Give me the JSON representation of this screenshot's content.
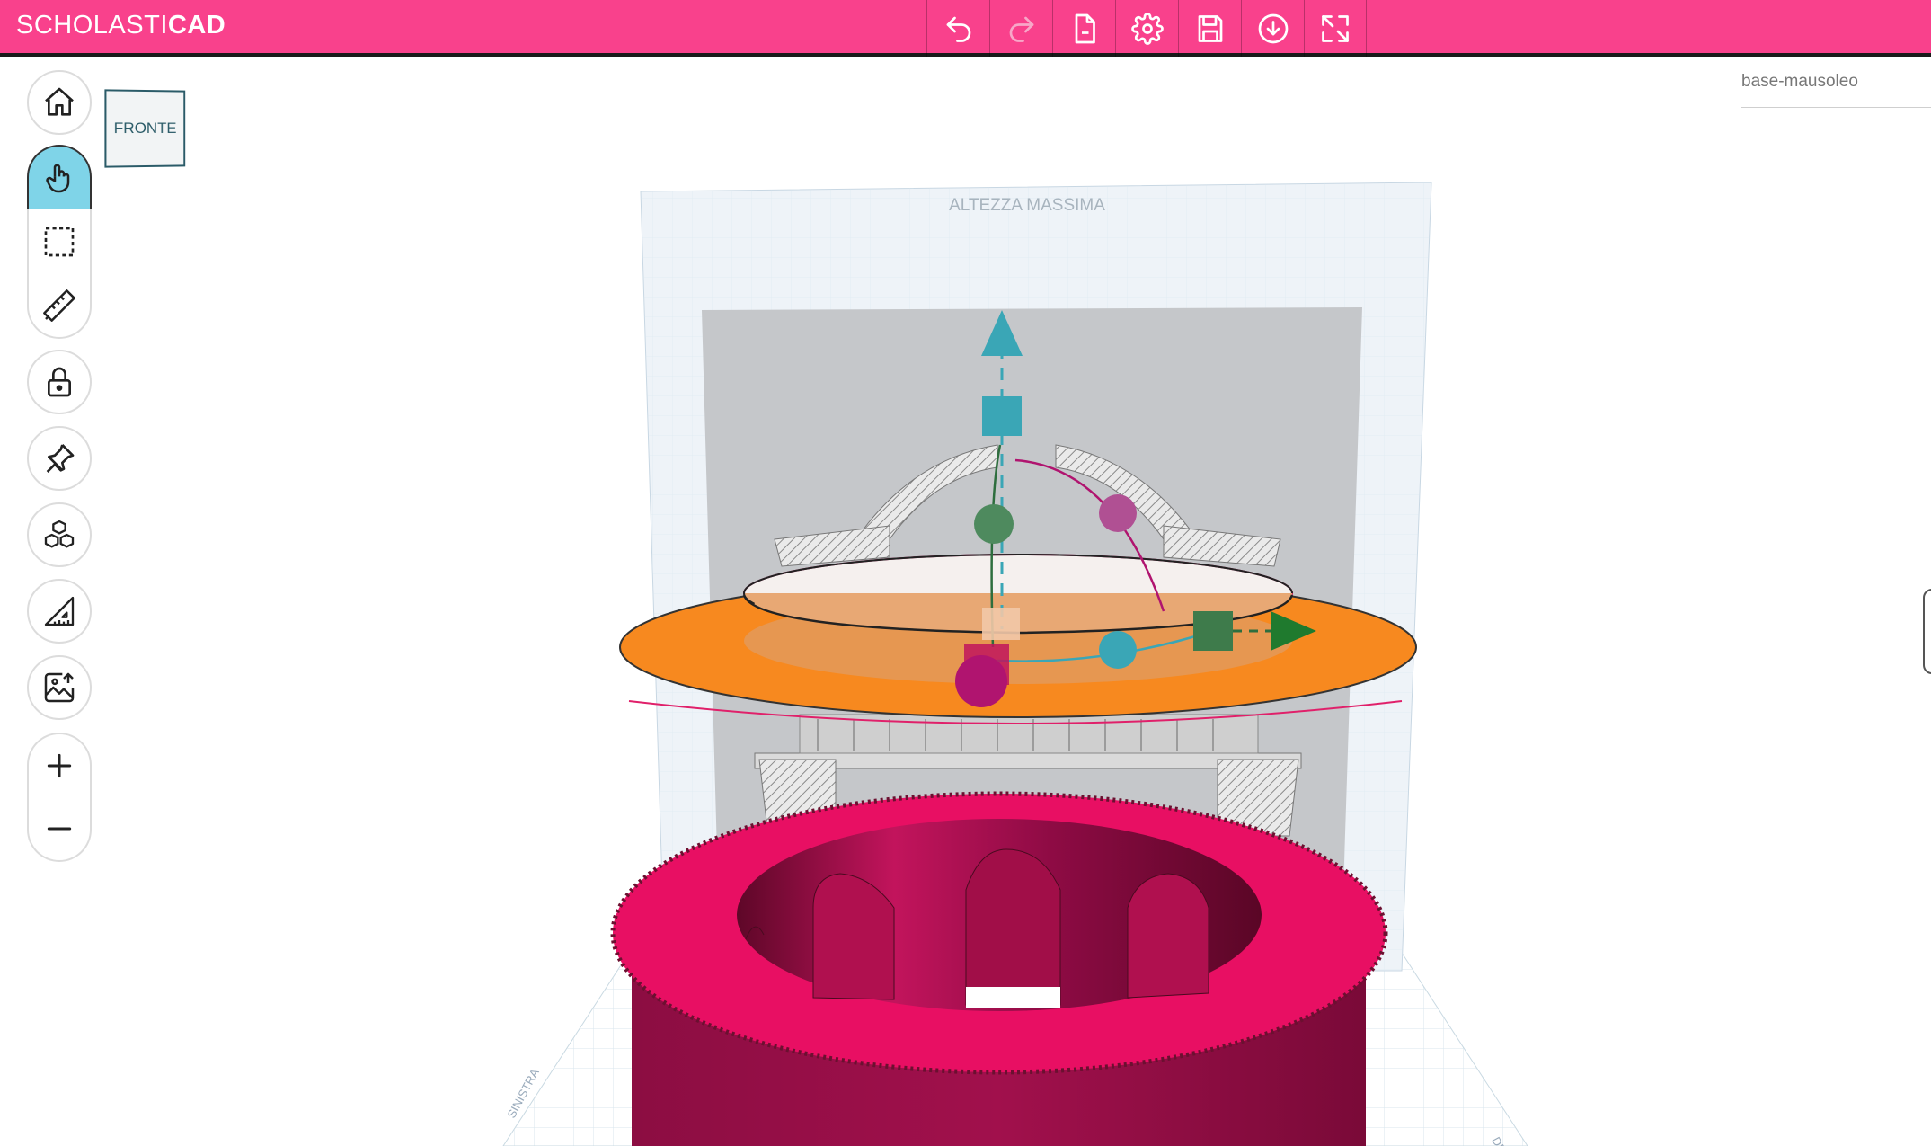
{
  "app": {
    "logo_light": "SCHOLASTI",
    "logo_bold": "CAD"
  },
  "toolbar": {
    "buttons": [
      {
        "icon": "undo-icon",
        "enabled": true
      },
      {
        "icon": "redo-icon",
        "enabled": false
      },
      {
        "icon": "new-file-icon",
        "enabled": true
      },
      {
        "icon": "gear-icon",
        "enabled": true
      },
      {
        "icon": "save-icon",
        "enabled": true
      },
      {
        "icon": "download-icon",
        "enabled": true
      },
      {
        "icon": "fullscreen-icon",
        "enabled": true
      }
    ]
  },
  "sidebar": {
    "tools": [
      {
        "icon": "home-icon"
      },
      {
        "icon": "hand-pointer-icon",
        "active": true
      },
      {
        "icon": "selection-box-icon"
      },
      {
        "icon": "ruler-icon"
      },
      {
        "icon": "lock-icon"
      },
      {
        "icon": "pin-icon"
      },
      {
        "icon": "cubes-icon"
      },
      {
        "icon": "set-square-icon"
      },
      {
        "icon": "image-upload-icon"
      },
      {
        "icon": "zoom-in-icon"
      },
      {
        "icon": "zoom-out-icon"
      }
    ]
  },
  "view_cube": {
    "face_label": "FRONTE"
  },
  "model": {
    "name": "base-mausoleo"
  },
  "scene": {
    "max_height_label": "ALTEZZA MASSIMA",
    "grid_label_left": "SINISTRA",
    "grid_label_right": "DESTRA"
  },
  "colors": {
    "topbar": "#f9418c",
    "active_tool": "#7fd4e8",
    "orange_disc": "#f7891f",
    "magenta_ring": "#e80f63",
    "ring_inner": "#8a0a3e",
    "gizmo_teal": "#3aa6b6",
    "gizmo_green": "#2e6e3e",
    "gizmo_magenta": "#b0146f"
  }
}
